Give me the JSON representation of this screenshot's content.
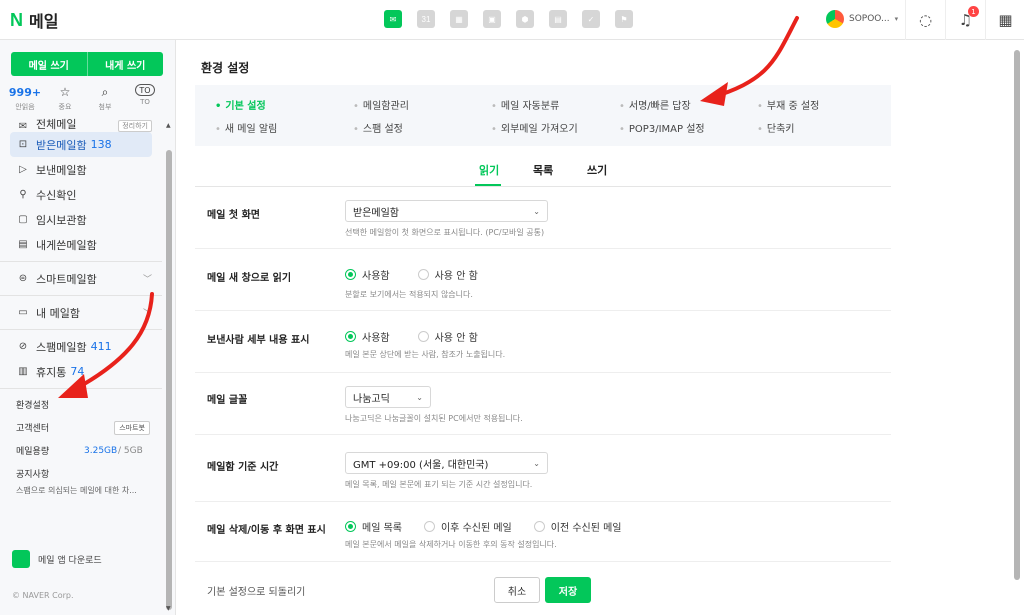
{
  "brand": {
    "logo_letter": "N",
    "logo_text": "메일"
  },
  "topbar": {
    "services": [
      "mail-icon",
      "calendar-icon",
      "photo-icon",
      "contacts-icon",
      "cloud-icon",
      "memo-icon",
      "todo-icon",
      "bookmark-icon"
    ],
    "calendar_num": "31",
    "user_name": "SOPOO...",
    "notif_count": "1"
  },
  "sidebar": {
    "compose": "메일 쓰기",
    "to_self": "내게 쓰기",
    "quick": [
      {
        "top": "999+",
        "label": "안읽음"
      },
      {
        "top": "☆",
        "label": "중요"
      },
      {
        "top": "⌕",
        "label": "첨부"
      },
      {
        "top": "TO",
        "label": "TO"
      }
    ],
    "items": [
      {
        "icon": "✉",
        "label": "전체메일",
        "badge": "정리하기"
      },
      {
        "icon": "⊡",
        "label": "받은메일함",
        "count": "138"
      },
      {
        "icon": "▷",
        "label": "보낸메일함"
      },
      {
        "icon": "⚲",
        "label": "수신확인"
      },
      {
        "icon": "▢",
        "label": "임시보관함"
      },
      {
        "icon": "▤",
        "label": "내게쓴메일함"
      },
      {
        "icon": "⊜",
        "label": "스마트메일함"
      },
      {
        "icon": "▭",
        "label": "내 메일함"
      },
      {
        "icon": "⊘",
        "label": "스팸메일함",
        "count": "411"
      },
      {
        "icon": "▥",
        "label": "휴지통",
        "count": "74"
      }
    ],
    "settings": "환경설정",
    "customer_center": "고객센터",
    "smartbot": "스마트봇",
    "storage_label": "메일용량",
    "storage_used": "3.25GB",
    "storage_total": "/ 5GB",
    "notice": "공지사항",
    "notice_text": "스팸으로 의심되는 메일에 대한 차...",
    "app_download": "메일 앱 다운로드",
    "copyright": "© NAVER Corp."
  },
  "main": {
    "title": "환경 설정",
    "menu": [
      "기본 설정",
      "메일함관리",
      "메일 자동분류",
      "서명/빠른 답장",
      "부재 중 설정",
      "새 메일 알림",
      "스팸 설정",
      "외부메일 가져오기",
      "POP3/IMAP 설정",
      "단축키"
    ],
    "tabs": [
      "읽기",
      "목록",
      "쓰기"
    ],
    "rows": {
      "first_screen": {
        "label": "메일 첫 화면",
        "value": "받은메일함",
        "desc": "선택한 메일함이 첫 화면으로 표시됩니다. (PC/모바일 공통)"
      },
      "new_window": {
        "label": "메일 새 창으로 읽기",
        "options": [
          "사용함",
          "사용 안 함"
        ],
        "desc": "분할로 보기에서는 적용되지 않습니다."
      },
      "sender_detail": {
        "label": "보낸사람 세부 내용 표시",
        "options": [
          "사용함",
          "사용 안 함"
        ],
        "desc": "메일 본문 상단에 받는 사람, 참조가 노출됩니다."
      },
      "font": {
        "label": "메일 글꼴",
        "value": "나눔고딕",
        "desc": "나눔고딕은 나눔글꼴이 설치된 PC에서만 적용됩니다."
      },
      "timezone": {
        "label": "메일함 기준 시간",
        "value": "GMT +09:00 (서울, 대한민국)",
        "desc": "메일 목록, 메일 본문에 표기 되는 기준 시간 설정입니다."
      },
      "after_delete": {
        "label": "메일 삭제/이동 후 화면 표시",
        "options": [
          "메일 목록",
          "이후 수신된 메일",
          "이전 수신된 메일"
        ],
        "desc": "메일 본문에서 메일을 삭제하거나 이동한 후의 동작 설정입니다."
      }
    },
    "reset": "기본 설정으로 되돌리기",
    "cancel": "취소",
    "save": "저장"
  },
  "colors": {
    "accent": "#03c75a",
    "annotation_arrow": "#e8221b"
  }
}
